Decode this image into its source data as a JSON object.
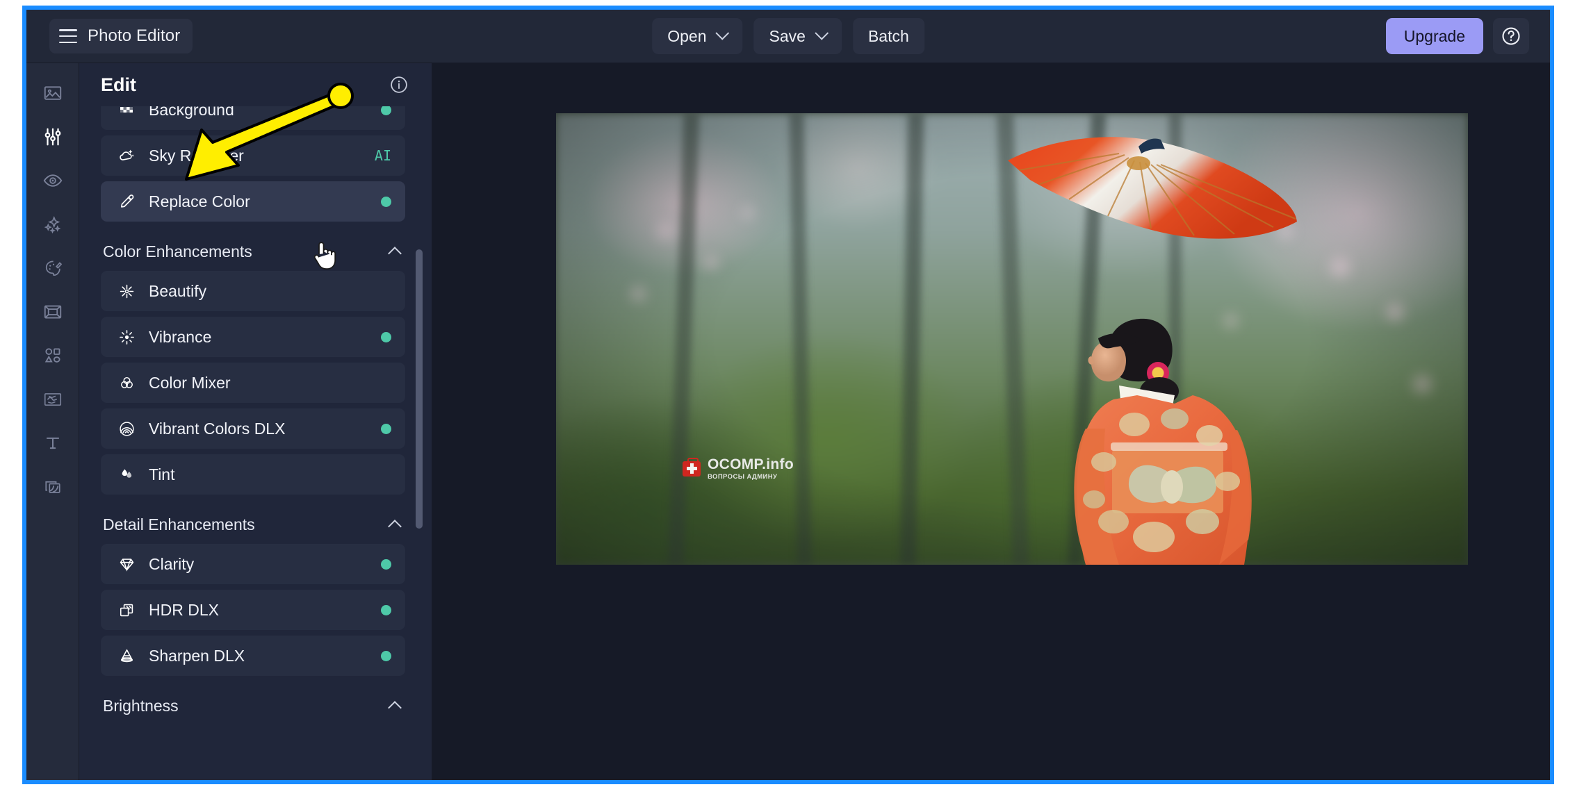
{
  "window": {
    "frame_color": "#1a8cff",
    "background": "#1c2030"
  },
  "topbar": {
    "menu_icon": "hamburger-icon",
    "app_title": "Photo Editor",
    "buttons": [
      {
        "label": "Open",
        "has_caret": true
      },
      {
        "label": "Save",
        "has_caret": true
      },
      {
        "label": "Batch",
        "has_caret": false
      }
    ],
    "upgrade_label": "Upgrade",
    "help_icon": "question-mark-icon",
    "upgrade_color": "#9b9bf5"
  },
  "rail": {
    "items": [
      {
        "icon": "image-icon",
        "active": false
      },
      {
        "icon": "sliders-icon",
        "active": true
      },
      {
        "icon": "eye-icon",
        "active": false
      },
      {
        "icon": "sparkles-icon",
        "active": false
      },
      {
        "icon": "palette-icon",
        "active": false
      },
      {
        "icon": "frame-icon",
        "active": false
      },
      {
        "icon": "shapes-icon",
        "active": false
      },
      {
        "icon": "texture-icon",
        "active": false
      },
      {
        "icon": "text-icon",
        "active": false
      },
      {
        "icon": "layers-icon",
        "active": false
      }
    ]
  },
  "panel": {
    "title": "Edit",
    "info_icon": "info-circle-icon",
    "accent_dot_color": "#4ec9a8",
    "groups": [
      {
        "kind": "tools",
        "items": [
          {
            "label": "Background",
            "icon": "checkerboard-icon",
            "dot": true,
            "badge": "",
            "hovered": false,
            "clipped": true
          },
          {
            "label": "Sky Replacer",
            "icon": "cloud-sun-icon",
            "dot": false,
            "badge": "AI",
            "hovered": false,
            "clipped": false
          },
          {
            "label": "Replace Color",
            "icon": "eyedropper-icon",
            "dot": true,
            "badge": "",
            "hovered": true,
            "clipped": false
          }
        ]
      },
      {
        "kind": "section",
        "label": "Color Enhancements",
        "collapse_icon": "chevron-up-icon",
        "items": [
          {
            "label": "Beautify",
            "icon": "flower-icon",
            "dot": false,
            "badge": ""
          },
          {
            "label": "Vibrance",
            "icon": "burst-icon",
            "dot": true,
            "badge": ""
          },
          {
            "label": "Color Mixer",
            "icon": "venn-circles-icon",
            "dot": false,
            "badge": ""
          },
          {
            "label": "Vibrant Colors DLX",
            "icon": "rainbow-icon",
            "dot": true,
            "badge": ""
          },
          {
            "label": "Tint",
            "icon": "droplets-icon",
            "dot": false,
            "badge": ""
          }
        ]
      },
      {
        "kind": "section",
        "label": "Detail Enhancements",
        "collapse_icon": "chevron-up-icon",
        "items": [
          {
            "label": "Clarity",
            "icon": "diamond-icon",
            "dot": true,
            "badge": ""
          },
          {
            "label": "HDR DLX",
            "icon": "stacked-squares-icon",
            "dot": true,
            "badge": ""
          },
          {
            "label": "Sharpen DLX",
            "icon": "cone-icon",
            "dot": true,
            "badge": ""
          }
        ]
      },
      {
        "kind": "section",
        "label": "Brightness",
        "collapse_icon": "chevron-up-icon",
        "items": []
      }
    ],
    "scrollbar": {
      "name": "panel-scrollbar"
    }
  },
  "canvas": {
    "photo_alt": "Woman in orange floral kimono holding a red Japanese parasol against blurred cherry blossom forest",
    "watermark": {
      "title": "OCOMP.info",
      "subtitle": "ВОПРОСЫ АДМИНУ",
      "badge_color": "#d9241f"
    }
  },
  "annotation": {
    "color": "#ffee00",
    "kind": "arrow-pointing-to-replace-color"
  },
  "cursor": {
    "kind": "pointing-hand-cursor"
  }
}
